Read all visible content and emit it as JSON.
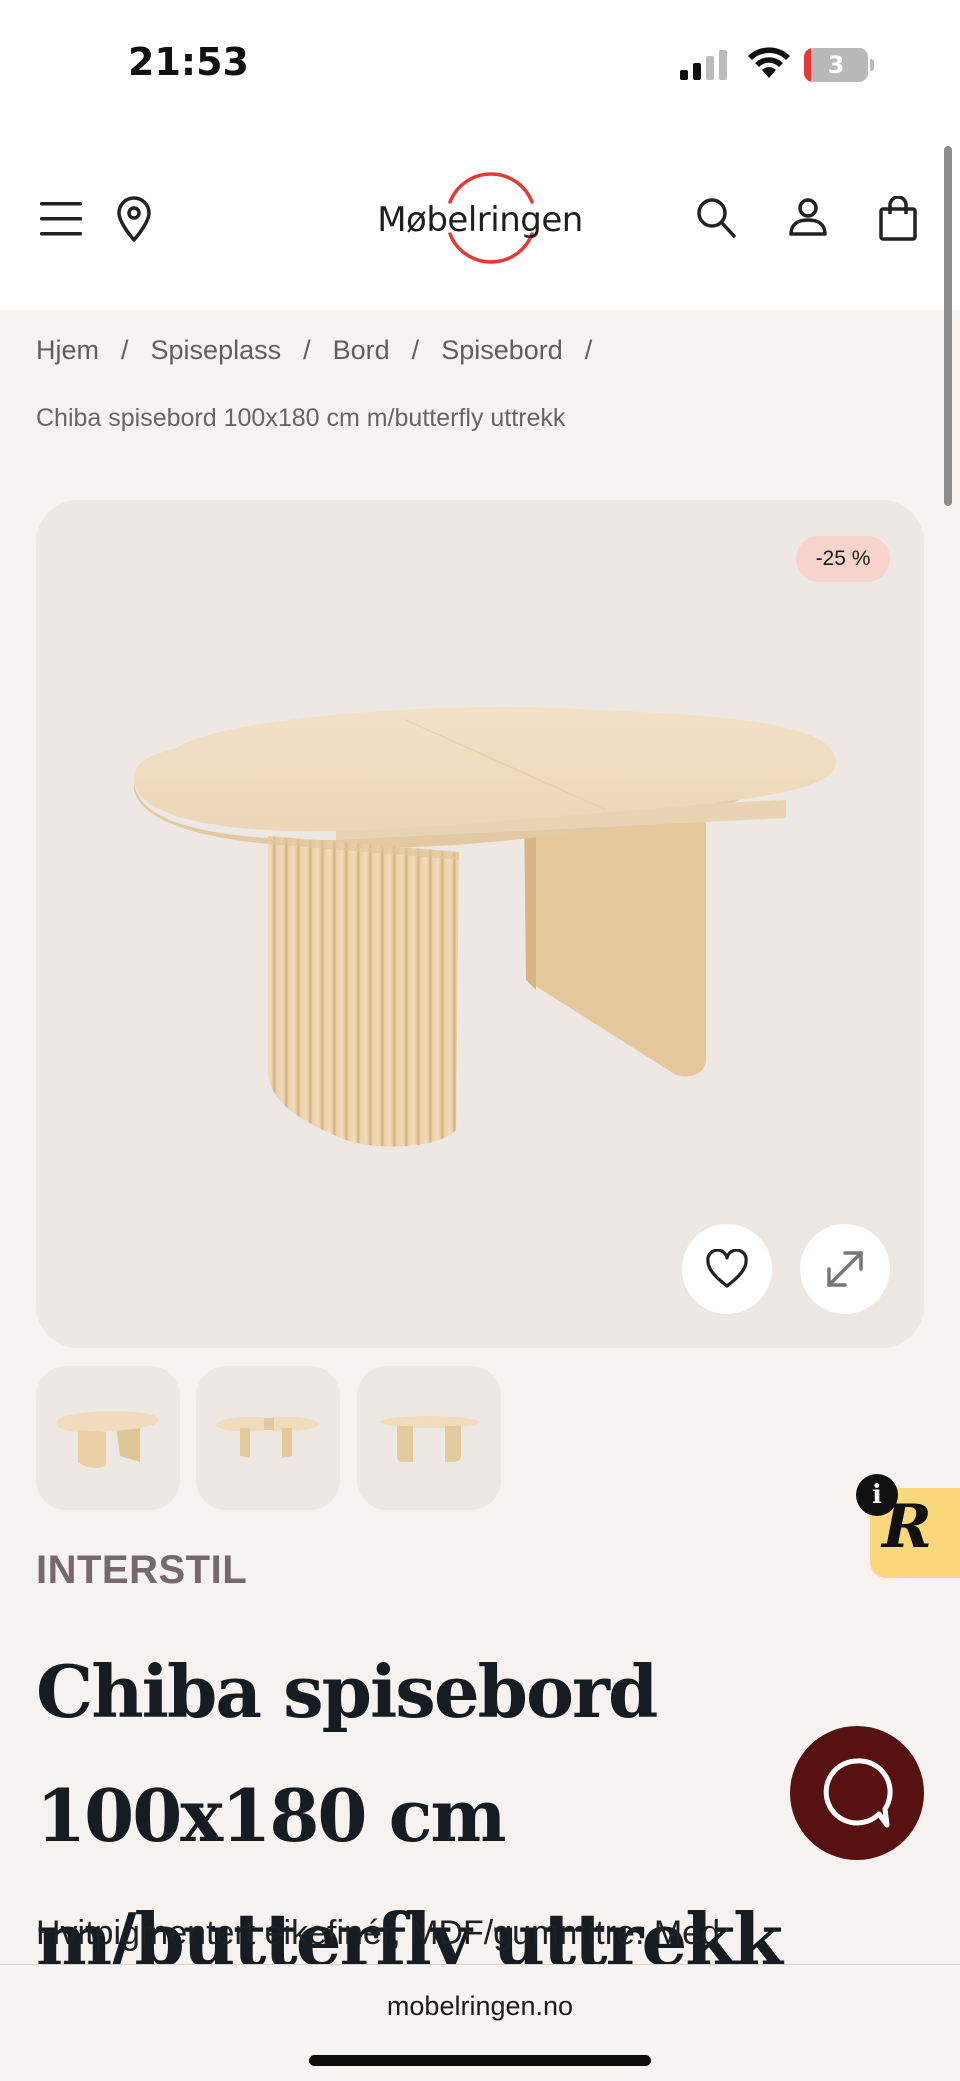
{
  "status_bar": {
    "time": "21:53",
    "battery_level": "3"
  },
  "header": {
    "brand_logo": "Møbelringen",
    "icons": [
      "menu-icon",
      "location-icon",
      "search-icon",
      "account-icon",
      "cart-icon"
    ]
  },
  "breadcrumb": {
    "items": [
      "Hjem",
      "Spiseplass",
      "Bord",
      "Spisebord"
    ],
    "separator": "/",
    "current": "Chiba spisebord 100x180 cm m/butterfly uttrekk"
  },
  "gallery": {
    "discount_badge": "-25 %",
    "thumbnail_count": 3,
    "buttons": [
      "heart-icon",
      "expand-icon"
    ]
  },
  "review_widget": {
    "letter": "R",
    "info": "i"
  },
  "product": {
    "brand": "INTERSTIL",
    "title": "Chiba spisebord 100x180 cm m/butterfly uttrekk",
    "description": "Hvitpigmentert eikefinér, MDF/gummitre. Med"
  },
  "browser": {
    "url": "mobelringen.no"
  },
  "colors": {
    "accent_red": "#e53935",
    "chat_button": "#581111",
    "badge_bg": "#f6d3cc",
    "page_bg": "#f5f2ef",
    "review_widget_bg": "#fbd87b"
  }
}
